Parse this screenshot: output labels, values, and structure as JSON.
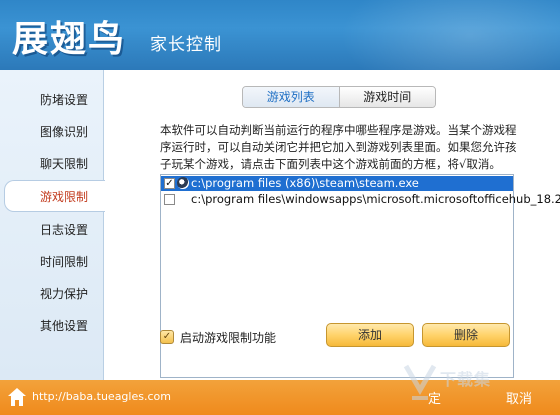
{
  "app": {
    "logo": "展翅鸟",
    "subtitle": "家长控制"
  },
  "sidebar": {
    "items": [
      {
        "label": "防堵设置"
      },
      {
        "label": "图像识别"
      },
      {
        "label": "聊天限制"
      },
      {
        "label": "游戏限制",
        "active": true
      },
      {
        "label": "日志设置"
      },
      {
        "label": "时间限制"
      },
      {
        "label": "视力保护"
      },
      {
        "label": "其他设置"
      }
    ]
  },
  "tabs": [
    {
      "label": "游戏列表",
      "active": true
    },
    {
      "label": "游戏时间"
    }
  ],
  "description": "本软件可以自动判断当前运行的程序中哪些程序是游戏。当某个游戏程序运行时，可以自动关闭它并把它加入到游戏列表里面。如果您允许孩子玩某个游戏，请点击下面列表中这个游戏前面的方框，将√取消。",
  "game_list": [
    {
      "path": "c:\\program files (x86)\\steam\\steam.exe",
      "checked": true,
      "selected": true
    },
    {
      "path": "c:\\program files\\windowsapps\\microsoft.microsoftofficehub_18.2",
      "checked": false,
      "selected": false
    }
  ],
  "enable": {
    "label": "启动游戏限制功能",
    "checked": true
  },
  "buttons": {
    "add": "添加",
    "delete": "删除"
  },
  "footer": {
    "url": "http://baba.tueagles.com",
    "ok": "定",
    "cancel": "取消"
  },
  "watermark": "下载集"
}
